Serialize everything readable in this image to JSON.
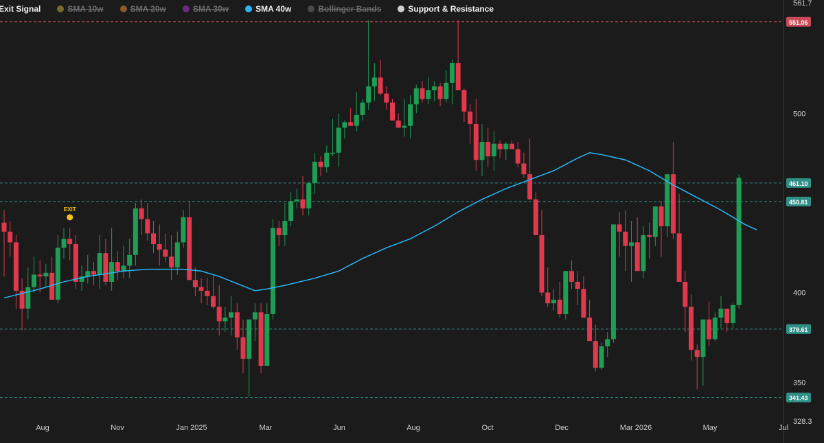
{
  "legend": [
    {
      "label": "Exit Signal",
      "color": "#f0c419",
      "active": true,
      "dot": false
    },
    {
      "label": "SMA 10w",
      "color": "#7a6a2a",
      "active": false,
      "dot": true
    },
    {
      "label": "SMA 20w",
      "color": "#8a5a2a",
      "active": false,
      "dot": true
    },
    {
      "label": "SMA 30w",
      "color": "#6a2a80",
      "active": false,
      "dot": true
    },
    {
      "label": "SMA 40w",
      "color": "#29b6f6",
      "active": true,
      "dot": true
    },
    {
      "label": "Bollinger Bands",
      "color": "#4a4a4a",
      "active": false,
      "dot": true
    },
    {
      "label": "Support & Resistance",
      "color": "#cfcfcf",
      "active": true,
      "dot": true
    }
  ],
  "colors": {
    "up": "#1f9d55",
    "down": "#e0394d",
    "sma": "#29b6f6",
    "grid": "#2a2a2a",
    "resistance": "#c94a5a",
    "support": "#2f8f86",
    "exit": "#f0c419"
  },
  "chart_data": {
    "type": "candlestick",
    "y_axis": {
      "min": 328.3,
      "max": 561.7,
      "ticks": [
        561.7,
        500,
        400,
        350,
        328.3
      ]
    },
    "x_tick_labels": [
      "Aug",
      "Nov",
      "Jan 2025",
      "Mar",
      "Jun",
      "Aug",
      "Oct",
      "Dec",
      "Mar 2026",
      "May",
      "Jul"
    ],
    "levels": [
      {
        "value": 551.06,
        "label": "551.06",
        "kind": "resistance"
      },
      {
        "value": 461.1,
        "label": "461.10",
        "kind": "support"
      },
      {
        "value": 450.81,
        "label": "450.81",
        "kind": "support"
      },
      {
        "value": 379.61,
        "label": "379.61",
        "kind": "support"
      },
      {
        "value": 341.43,
        "label": "341.43",
        "kind": "support"
      }
    ],
    "exit_signal": {
      "label": "EXIT",
      "index": 11,
      "value": 442
    },
    "candles": [
      [
        439,
        446,
        409,
        434
      ],
      [
        434,
        440,
        420,
        428
      ],
      [
        428,
        432,
        391,
        401
      ],
      [
        401,
        408,
        379,
        391
      ],
      [
        391,
        414,
        385,
        403
      ],
      [
        403,
        420,
        400,
        410
      ],
      [
        410,
        418,
        400,
        409
      ],
      [
        409,
        416,
        403,
        411
      ],
      [
        411,
        420,
        397,
        396
      ],
      [
        396,
        432,
        394,
        425
      ],
      [
        425,
        436,
        419,
        430
      ],
      [
        430,
        436,
        418,
        427
      ],
      [
        427,
        432,
        402,
        406
      ],
      [
        406,
        415,
        401,
        409
      ],
      [
        409,
        421,
        405,
        412
      ],
      [
        412,
        417,
        404,
        410
      ],
      [
        410,
        432,
        402,
        422
      ],
      [
        422,
        430,
        404,
        406
      ],
      [
        406,
        436,
        401,
        417
      ],
      [
        417,
        423,
        407,
        412
      ],
      [
        412,
        426,
        408,
        415
      ],
      [
        415,
        430,
        408,
        421
      ],
      [
        421,
        450,
        415,
        447
      ],
      [
        447,
        452,
        432,
        441
      ],
      [
        441,
        450,
        429,
        433
      ],
      [
        433,
        440,
        422,
        427
      ],
      [
        427,
        438,
        415,
        424
      ],
      [
        424,
        433,
        417,
        420
      ],
      [
        420,
        432,
        407,
        414
      ],
      [
        414,
        434,
        410,
        428
      ],
      [
        428,
        446,
        425,
        442
      ],
      [
        442,
        451,
        414,
        407
      ],
      [
        407,
        414,
        398,
        403
      ],
      [
        403,
        408,
        394,
        401
      ],
      [
        401,
        408,
        393,
        398
      ],
      [
        398,
        410,
        391,
        392
      ],
      [
        392,
        404,
        376,
        384
      ],
      [
        384,
        392,
        378,
        386
      ],
      [
        386,
        398,
        376,
        389
      ],
      [
        389,
        394,
        368,
        375
      ],
      [
        375,
        385,
        355,
        363
      ],
      [
        363,
        382,
        342,
        385
      ],
      [
        385,
        394,
        373,
        389
      ],
      [
        389,
        394,
        355,
        359
      ],
      [
        359,
        394,
        360,
        388
      ],
      [
        388,
        441,
        385,
        436
      ],
      [
        436,
        440,
        426,
        432
      ],
      [
        432,
        450,
        426,
        440
      ],
      [
        440,
        456,
        437,
        451
      ],
      [
        451,
        458,
        447,
        452
      ],
      [
        452,
        465,
        443,
        447
      ],
      [
        447,
        462,
        443,
        461
      ],
      [
        461,
        478,
        455,
        473
      ],
      [
        473,
        476,
        465,
        470
      ],
      [
        470,
        482,
        467,
        478
      ],
      [
        478,
        497,
        476,
        478
      ],
      [
        478,
        500,
        470,
        492
      ],
      [
        492,
        496,
        486,
        495
      ],
      [
        495,
        503,
        493,
        493
      ],
      [
        493,
        512,
        490,
        499
      ],
      [
        499,
        508,
        496,
        506
      ],
      [
        506,
        552,
        502,
        515
      ],
      [
        515,
        528,
        507,
        520
      ],
      [
        520,
        530,
        510,
        511
      ],
      [
        511,
        515,
        502,
        506
      ],
      [
        506,
        508,
        496,
        496
      ],
      [
        496,
        500,
        492,
        492
      ],
      [
        492,
        508,
        487,
        493
      ],
      [
        493,
        510,
        486,
        505
      ],
      [
        505,
        516,
        500,
        514
      ],
      [
        514,
        518,
        506,
        508
      ],
      [
        508,
        520,
        505,
        513
      ],
      [
        513,
        518,
        507,
        515
      ],
      [
        515,
        517,
        504,
        508
      ],
      [
        508,
        524,
        506,
        517
      ],
      [
        517,
        530,
        505,
        528
      ],
      [
        528,
        552,
        515,
        513
      ],
      [
        513,
        514,
        495,
        501
      ],
      [
        501,
        505,
        483,
        494
      ],
      [
        494,
        508,
        468,
        474
      ],
      [
        474,
        494,
        465,
        484
      ],
      [
        484,
        492,
        470,
        476
      ],
      [
        476,
        490,
        468,
        483
      ],
      [
        483,
        485,
        475,
        480
      ],
      [
        480,
        484,
        474,
        483
      ],
      [
        483,
        485,
        480,
        480
      ],
      [
        480,
        484,
        470,
        472
      ],
      [
        472,
        478,
        464,
        466
      ],
      [
        466,
        486,
        460,
        452
      ],
      [
        452,
        456,
        438,
        432
      ],
      [
        432,
        446,
        398,
        400
      ],
      [
        400,
        414,
        392,
        394
      ],
      [
        394,
        402,
        390,
        396
      ],
      [
        396,
        406,
        386,
        388
      ],
      [
        388,
        412,
        385,
        412
      ],
      [
        412,
        418,
        402,
        406
      ],
      [
        406,
        412,
        393,
        402
      ],
      [
        402,
        409,
        388,
        386
      ],
      [
        386,
        396,
        374,
        373
      ],
      [
        373,
        382,
        356,
        358
      ],
      [
        358,
        372,
        357,
        370
      ],
      [
        370,
        378,
        364,
        374
      ],
      [
        374,
        438,
        372,
        438
      ],
      [
        438,
        445,
        420,
        434
      ],
      [
        434,
        446,
        412,
        426
      ],
      [
        426,
        440,
        406,
        428
      ],
      [
        428,
        442,
        414,
        412
      ],
      [
        412,
        437,
        408,
        432
      ],
      [
        432,
        439,
        419,
        431
      ],
      [
        431,
        447,
        426,
        448
      ],
      [
        448,
        451,
        420,
        437
      ],
      [
        437,
        466,
        431,
        466
      ],
      [
        466,
        484,
        430,
        433
      ],
      [
        433,
        455,
        410,
        406
      ],
      [
        406,
        412,
        378,
        392
      ],
      [
        392,
        399,
        362,
        368
      ],
      [
        368,
        371,
        346,
        364
      ],
      [
        364,
        374,
        348,
        385
      ],
      [
        385,
        395,
        370,
        374
      ],
      [
        374,
        389,
        373,
        386
      ],
      [
        386,
        398,
        380,
        391
      ],
      [
        391,
        390,
        378,
        383
      ],
      [
        383,
        394,
        380,
        393
      ],
      [
        393,
        466,
        391,
        464
      ]
    ],
    "sma40": [
      [
        0,
        397
      ],
      [
        6,
        402
      ],
      [
        10,
        406
      ],
      [
        14,
        409
      ],
      [
        18,
        411
      ],
      [
        20,
        412
      ],
      [
        24,
        413
      ],
      [
        27,
        413
      ],
      [
        30,
        413
      ],
      [
        33,
        412
      ],
      [
        36,
        409
      ],
      [
        39,
        405
      ],
      [
        42,
        401
      ],
      [
        44,
        402
      ],
      [
        47,
        404
      ],
      [
        52,
        408
      ],
      [
        56,
        412
      ],
      [
        60,
        419
      ],
      [
        64,
        425
      ],
      [
        68,
        430
      ],
      [
        72,
        437
      ],
      [
        76,
        445
      ],
      [
        80,
        452
      ],
      [
        84,
        458
      ],
      [
        88,
        463
      ],
      [
        92,
        468
      ],
      [
        96,
        475
      ],
      [
        98,
        478
      ],
      [
        100,
        477
      ],
      [
        104,
        474
      ],
      [
        108,
        468
      ],
      [
        112,
        460
      ],
      [
        116,
        453
      ],
      [
        120,
        446
      ],
      [
        124,
        438
      ],
      [
        126,
        435
      ]
    ]
  }
}
